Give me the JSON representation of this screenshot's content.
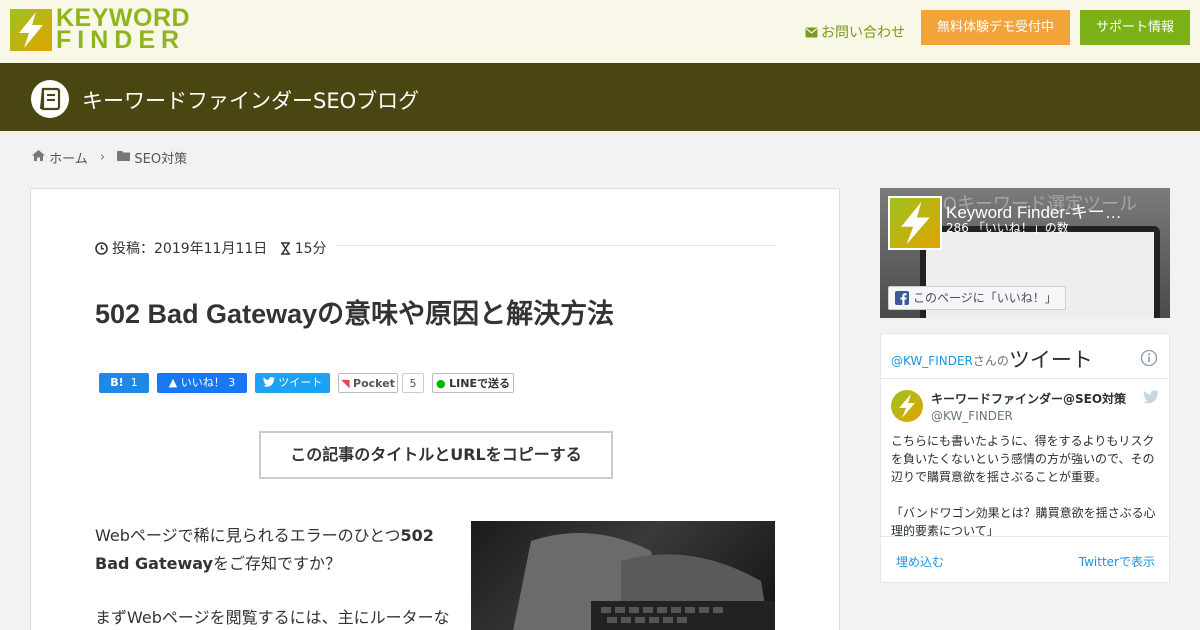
{
  "header": {
    "logo": {
      "line1": "KEYWORD",
      "line2": "FINDER"
    },
    "contact_label": "お問い合わせ",
    "demo_button": "無料体験デモ受付中",
    "support_button": "サポート情報",
    "colors": {
      "bg": "#f9f7e8",
      "brand_green": "#8fb51e",
      "demo_orange": "#f0a43a",
      "support_green": "#7cb218"
    }
  },
  "blog": {
    "title": "キーワードファインダーSEOブログ",
    "bar_color": "#4a4611"
  },
  "breadcrumb": {
    "home": "ホーム",
    "category": "SEO対策"
  },
  "post": {
    "posted_label": "投稿：2019年11月11日",
    "read_time": "15分",
    "title": "502 Bad Gatewayの意味や原因と解決方法",
    "copy_button": "この記事のタイトルとURLをコピーする",
    "paragraph1_prefix": "Webページで稀に見られるエラーのひとつ",
    "paragraph1_bold": "502 Bad Gateway",
    "paragraph1_suffix": "をご存知ですか？",
    "paragraph2": "まずWebページを閲覧するには、主にルーターな"
  },
  "share": {
    "hatena_label": "B!",
    "hatena_count": "1",
    "fb_label": "いいね！",
    "fb_count": "3",
    "tweet_label": "ツイート",
    "pocket_label": "Pocket",
    "pocket_count": "5",
    "line_label": "LINEで送る"
  },
  "facebook_widget": {
    "page_name": "Keyword Finder-キー…",
    "likes": "286 「いいね！」の数",
    "like_button": "このページに「いいね！」",
    "bg_text": "SEOキーワード選定ツール"
  },
  "twitter_widget": {
    "handle_link": "@KW_FINDER",
    "san": "さんの",
    "heading": "ツイート",
    "name": "キーワードファインダー@SEO対策",
    "handle": "@KW_FINDER",
    "text1": "こちらにも書いたように、得をするよりもリスクを負いたくないという感情の方が強いので、その辺りで購買意欲を揺さぶることが重要。",
    "text2": "「バンドワゴン効果とは？購買意欲を揺さぶる心理的要素について」",
    "embed": "埋め込む",
    "view_on": "Twitterで表示"
  }
}
